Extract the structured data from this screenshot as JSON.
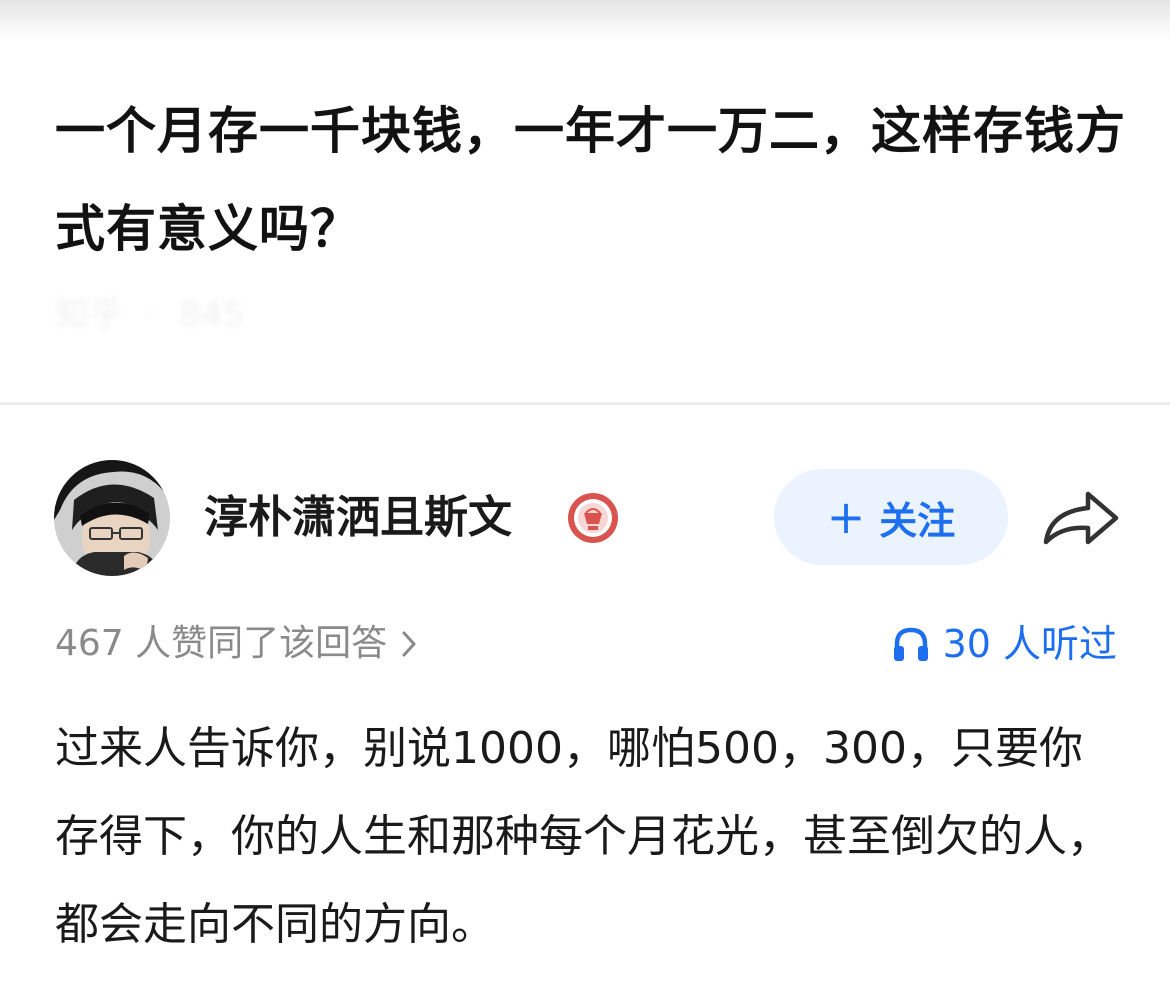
{
  "question": {
    "title": "一个月存一千块钱，一年才一万二，这样存钱方式有意义吗？",
    "meta_blurred": [
      "知乎",
      "·",
      "845"
    ]
  },
  "author": {
    "name": "淳朴潇洒且斯文",
    "badge_icon": "badge-icon",
    "follow_label": "关注",
    "follow_plus": "+",
    "share_icon": "share-icon"
  },
  "stats": {
    "votes_text": "467 人赞同了该回答",
    "listen_text": "30 人听过"
  },
  "answer": {
    "text": "过来人告诉你，别说1000，哪怕500，300，只要你存得下，你的人生和那种每个月花光，甚至倒欠的人，都会走向不同的方向。"
  },
  "colors": {
    "accent": "#1d6ff0",
    "follow_bg": "#ebf3fe",
    "muted_text": "#8a8a8a",
    "badge_red": "#d9534f"
  }
}
